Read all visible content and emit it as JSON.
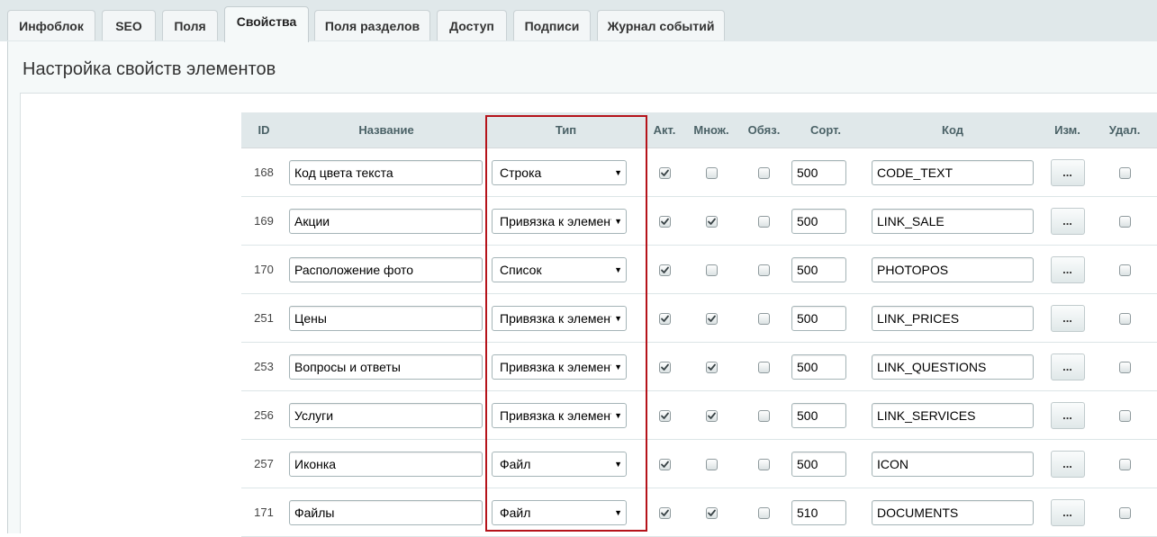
{
  "tabs": [
    {
      "label": "Инфоблок"
    },
    {
      "label": "SEO"
    },
    {
      "label": "Поля"
    },
    {
      "label": "Свойства"
    },
    {
      "label": "Поля разделов"
    },
    {
      "label": "Доступ"
    },
    {
      "label": "Подписи"
    },
    {
      "label": "Журнал событий"
    }
  ],
  "page": {
    "title": "Настройка свойств элементов"
  },
  "table": {
    "headers": {
      "id": "ID",
      "name": "Название",
      "type": "Тип",
      "active": "Акт.",
      "multiple": "Множ.",
      "required": "Обяз.",
      "sort": "Сорт.",
      "code": "Код",
      "edit": "Изм.",
      "delete": "Удал."
    },
    "edit_label": "...",
    "rows": [
      {
        "id": "168",
        "name": "Код цвета текста",
        "type": "Строка",
        "active": true,
        "multiple": false,
        "required": false,
        "sort": "500",
        "code": "CODE_TEXT",
        "delete": false
      },
      {
        "id": "169",
        "name": "Акции",
        "type": "Привязка к элементам",
        "active": true,
        "multiple": true,
        "required": false,
        "sort": "500",
        "code": "LINK_SALE",
        "delete": false
      },
      {
        "id": "170",
        "name": "Расположение фото",
        "type": "Список",
        "active": true,
        "multiple": false,
        "required": false,
        "sort": "500",
        "code": "PHOTOPOS",
        "delete": false
      },
      {
        "id": "251",
        "name": "Цены",
        "type": "Привязка к элементам",
        "active": true,
        "multiple": true,
        "required": false,
        "sort": "500",
        "code": "LINK_PRICES",
        "delete": false
      },
      {
        "id": "253",
        "name": "Вопросы и ответы",
        "type": "Привязка к элементам",
        "active": true,
        "multiple": true,
        "required": false,
        "sort": "500",
        "code": "LINK_QUESTIONS",
        "delete": false
      },
      {
        "id": "256",
        "name": "Услуги",
        "type": "Привязка к элементам",
        "active": true,
        "multiple": true,
        "required": false,
        "sort": "500",
        "code": "LINK_SERVICES",
        "delete": false
      },
      {
        "id": "257",
        "name": "Иконка",
        "type": "Файл",
        "active": true,
        "multiple": false,
        "required": false,
        "sort": "500",
        "code": "ICON",
        "delete": false
      },
      {
        "id": "171",
        "name": "Файлы",
        "type": "Файл",
        "active": true,
        "multiple": true,
        "required": false,
        "sort": "510",
        "code": "DOCUMENTS",
        "delete": false
      }
    ]
  },
  "colors": {
    "highlight": "#b5131a",
    "header_bg": "#e0e8ea",
    "tab_strip_bg": "#e0e8ea"
  },
  "icons": {
    "dropdown": "dropdown-arrow-icon",
    "check": "checkmark-icon"
  }
}
